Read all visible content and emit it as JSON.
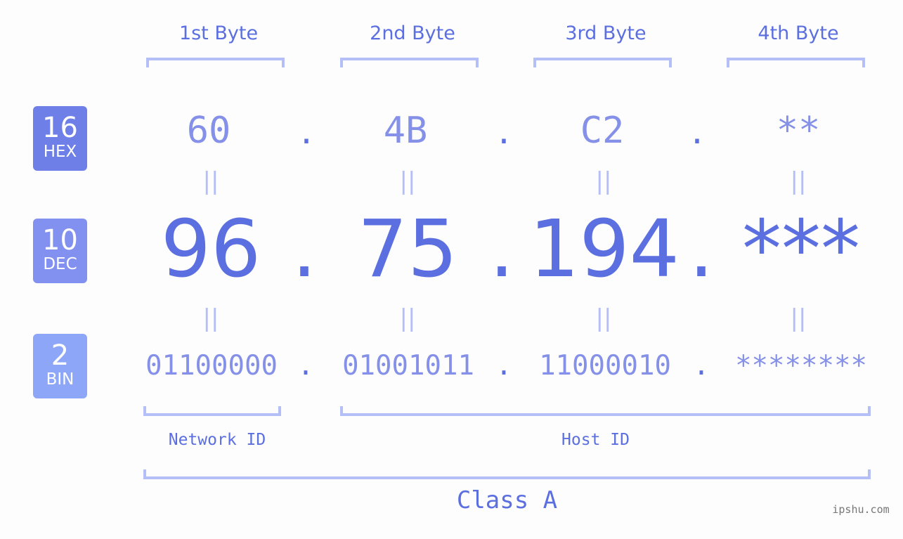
{
  "byte_headers": [
    "1st Byte",
    "2nd Byte",
    "3rd Byte",
    "4th Byte"
  ],
  "badges": [
    {
      "number": "16",
      "label": "HEX",
      "color": "#6e7fe8"
    },
    {
      "number": "10",
      "label": "DEC",
      "color": "#8290f0"
    },
    {
      "number": "2",
      "label": "BIN",
      "color": "#8ea6f8"
    }
  ],
  "separator": ".",
  "equals_glyph": "||",
  "hex": [
    "60",
    "4B",
    "C2",
    "**"
  ],
  "dec": [
    "96",
    "75",
    "194",
    "***"
  ],
  "bin": [
    "01100000",
    "01001011",
    "11000010",
    "********"
  ],
  "labels": {
    "network_id": "Network ID",
    "host_id": "Host ID",
    "class": "Class A"
  },
  "watermark": "ipshu.com",
  "colors": {
    "primary": "#5b6fe0",
    "secondary": "#8590e8",
    "bracket": "#b4bff8",
    "background": "#fcfdfc"
  }
}
